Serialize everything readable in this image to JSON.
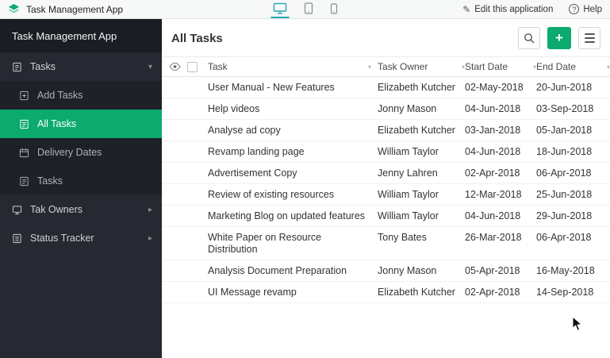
{
  "topbar": {
    "app_title": "Task Management App",
    "edit_label": "Edit this application",
    "help_label": "Help"
  },
  "sidebar": {
    "title": "Task Management App",
    "items": [
      {
        "label": "Tasks"
      },
      {
        "label": "Add Tasks"
      },
      {
        "label": "All Tasks",
        "selected": true
      },
      {
        "label": "Delivery Dates"
      },
      {
        "label": "Tasks"
      },
      {
        "label": "Tak Owners"
      },
      {
        "label": "Status Tracker"
      }
    ]
  },
  "main": {
    "title": "All Tasks",
    "table": {
      "columns": [
        "Task",
        "Task Owner",
        "Start Date",
        "End Date"
      ],
      "rows": [
        {
          "task": "User Manual - New Features",
          "owner": "Elizabeth Kutcher",
          "start": "02-May-2018",
          "end": "20-Jun-2018"
        },
        {
          "task": "Help videos",
          "owner": "Jonny Mason",
          "start": "04-Jun-2018",
          "end": "03-Sep-2018"
        },
        {
          "task": "Analyse ad copy",
          "owner": "Elizabeth Kutcher",
          "start": "03-Jan-2018",
          "end": "05-Jan-2018"
        },
        {
          "task": "Revamp landing page",
          "owner": "William Taylor",
          "start": "04-Jun-2018",
          "end": "18-Jun-2018"
        },
        {
          "task": "Advertisement Copy",
          "owner": "Jenny Lahren",
          "start": "02-Apr-2018",
          "end": "06-Apr-2018"
        },
        {
          "task": "Review of existing resources",
          "owner": "William Taylor",
          "start": "12-Mar-2018",
          "end": "25-Jun-2018"
        },
        {
          "task": "Marketing Blog on updated features",
          "owner": "William Taylor",
          "start": "04-Jun-2018",
          "end": "29-Jun-2018"
        },
        {
          "task": "White Paper on Resource Distribution",
          "owner": "Tony Bates",
          "start": "26-Mar-2018",
          "end": "06-Apr-2018"
        },
        {
          "task": "Analysis Document Preparation",
          "owner": "Jonny Mason",
          "start": "05-Apr-2018",
          "end": "16-May-2018"
        },
        {
          "task": "UI Message revamp",
          "owner": "Elizabeth Kutcher",
          "start": "02-Apr-2018",
          "end": "14-Sep-2018"
        }
      ]
    }
  },
  "icons": {
    "chevron_down": "▾",
    "chevron_right": "▸",
    "sort_arrow": "▾",
    "plus": "+",
    "pencil": "✎",
    "question": "?"
  },
  "colors": {
    "accent_green": "#0caa6e",
    "sidebar_bg": "#262931",
    "active_device_teal": "#2ba6b4"
  }
}
